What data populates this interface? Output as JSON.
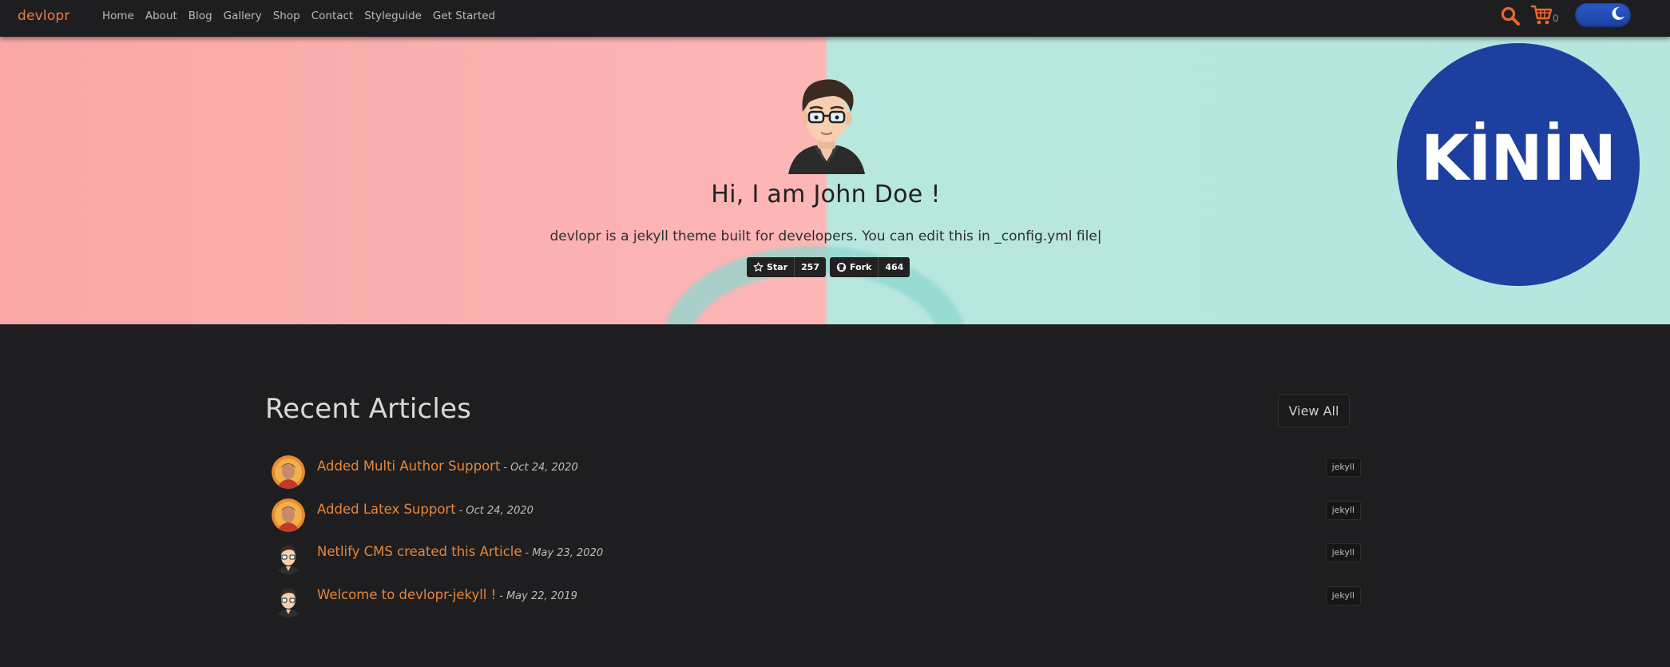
{
  "navbar": {
    "brand": "devlopr",
    "links": [
      "Home",
      "About",
      "Blog",
      "Gallery",
      "Shop",
      "Contact",
      "Styleguide",
      "Get Started"
    ],
    "cart_count": "0",
    "icons": {
      "search": "search-icon",
      "cart": "cart-icon",
      "theme_toggle": "moon-icon"
    },
    "accent_color": "#f07e3b"
  },
  "hero": {
    "title": "Hi, I am John Doe !",
    "subtitle": "devlopr is a jekyll theme built for developers. You can edit this in _config.yml file|",
    "github": {
      "star_label": "Star",
      "star_count": "257",
      "fork_label": "Fork",
      "fork_count": "464"
    },
    "colors": {
      "left": "#fdb6b6",
      "right": "#b6e6de"
    }
  },
  "badge": {
    "text": "KİNİN",
    "color": "#1d3fa0"
  },
  "articles": {
    "section_title": "Recent Articles",
    "view_all_label": "View All",
    "items": [
      {
        "title": "Added Multi Author Support",
        "date": "Oct 24, 2020",
        "tag": "jekyll",
        "avatar": "author-photo"
      },
      {
        "title": "Added Latex Support",
        "date": "Oct 24, 2020",
        "tag": "jekyll",
        "avatar": "author-photo"
      },
      {
        "title": "Netlify CMS created this Article",
        "date": "May 23, 2020",
        "tag": "jekyll",
        "avatar": "cartoon-avatar"
      },
      {
        "title": "Welcome to devlopr-jekyll !",
        "date": "May 22, 2019",
        "tag": "jekyll",
        "avatar": "cartoon-avatar"
      }
    ],
    "link_color": "#e6863a"
  }
}
